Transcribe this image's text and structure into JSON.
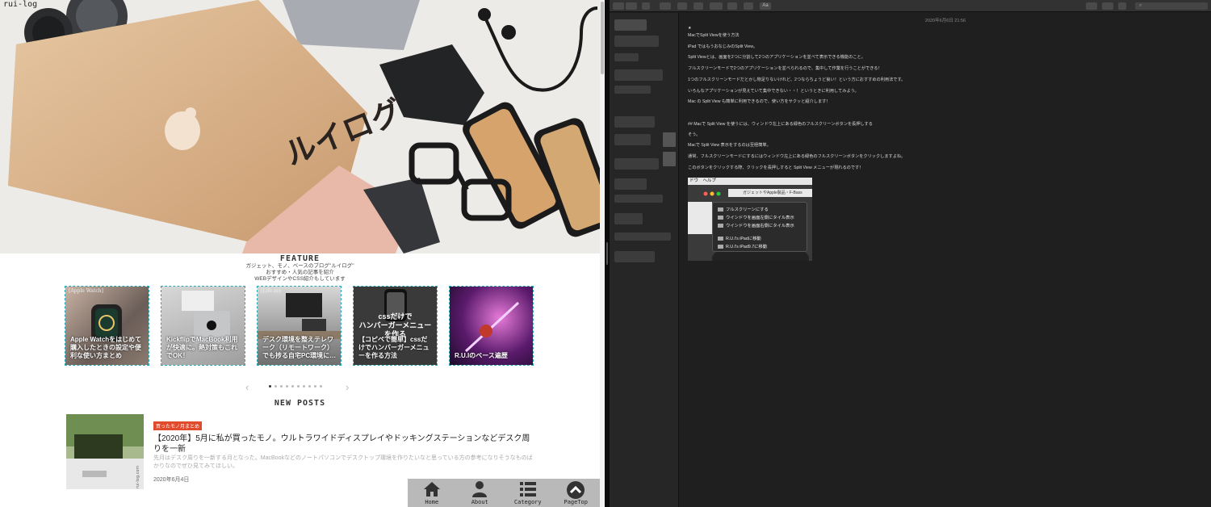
{
  "browser": {
    "site_logo": "rui-log",
    "hero": {
      "laptop_text": "ルイログ"
    },
    "feature": {
      "title": "FEATURE",
      "desc_lines": [
        "ガジェット、モノ、ベースのブログ\"ルイログ\"",
        "おすすめ・人気の記事を紹介",
        "WEBデザインやCSS紹介もしています"
      ]
    },
    "cards": [
      {
        "tag": "[Apple Watch]",
        "title": "Apple Watchをはじめて購入したときの設定や便利な使い方まとめ",
        "overlay": ""
      },
      {
        "tag": "",
        "title": "KickflipでMacBook利用が快適に。熱対策もこれでOK！",
        "overlay": ""
      },
      {
        "tag": "[Life mo",
        "title": "デスク環境を整えテレワーク（リモートワーク）でも捗る自宅PC環境に…",
        "overlay": ""
      },
      {
        "tag": "",
        "title": "【コピペで簡単】cssだけでハンバーガーメニューを作る方法",
        "overlay": "cssだけで\nハンバーガーメニュー\nを作る"
      },
      {
        "tag": "",
        "title": "R.U.Iのベース遍歴",
        "overlay": ""
      }
    ],
    "slider": {
      "prev": "‹",
      "next": "›",
      "dot_count": 10,
      "active_index": 0
    },
    "new_posts": {
      "title": "NEW POSTS",
      "post": {
        "category": "買ったモノ月まとめ",
        "title": "【2020年】5月に私が買ったモノ。ウルトラワイドディスプレイやドッキングステーションなどデスク周りを一新",
        "excerpt": "先月はデスク周りを一新する月となった。MacBookなどのノートパソコンでデスクトップ環境を作りたいなと思っている方の参考になりそうなものばかりなのでぜひ見てみてほしい。",
        "date": "2020年6月4日",
        "thumb_text": "rui-log.com"
      }
    },
    "bottom_nav": [
      {
        "label": "Home",
        "icon": "home-icon"
      },
      {
        "label": "About",
        "icon": "person-icon"
      },
      {
        "label": "Category",
        "icon": "list-icon"
      },
      {
        "label": "PageTop",
        "icon": "chevron-up-circle-icon"
      }
    ]
  },
  "notes": {
    "toolbar": {
      "format_label": "Aa"
    },
    "date": "2020年6月6日 21:56",
    "lines": [
      "★",
      "MacでSplit Viewを使う方法",
      "iPad ではもうおなじみのSplit View。",
      "Split Viewとは、画面を2つに分割して2つのアプリケーションを並べて表示できる機能のこと。",
      "フルスクリーンモードで2つのアプリケーションを並べられるので、集中して作業を行うことができる！",
      "1つのフルスクリーンモードだとかし物足りないけれど、2つならちょうど良い！という方におすすめの利用法です。",
      "いろんなアプリケーションが見えていて集中できない・・！というときに利用してみよう。",
      "Mac の Split View も簡単に利用できるので、使い方をサクッと紹介します！",
      "## Macで Split View を使うには、ウィンドウ左上にある緑色のフルスクリーンボタンを長押しする",
      "そう。",
      "Macで Split View 表示をするのは至極簡単。",
      "通常、フルスクリーンモードにするにはウィンドウ左上にある緑色のフルスクリーンボタンをクリックしますよね。",
      "このボタンをクリックする際、クリックを長押しすると Split View メニューが現れるのです！"
    ],
    "screenshot": {
      "menubar": "ドウ　ヘルプ",
      "tab_title": "ガジェットやApple製品・F-Bass",
      "menu_items": [
        "フルスクリーンにする",
        "ウインドウを画面左側にタイル表示",
        "ウインドウを画面右側にタイル表示",
        "R.U.I's iPadに移動",
        "R.U.I's iPad9.7に移動"
      ]
    }
  }
}
